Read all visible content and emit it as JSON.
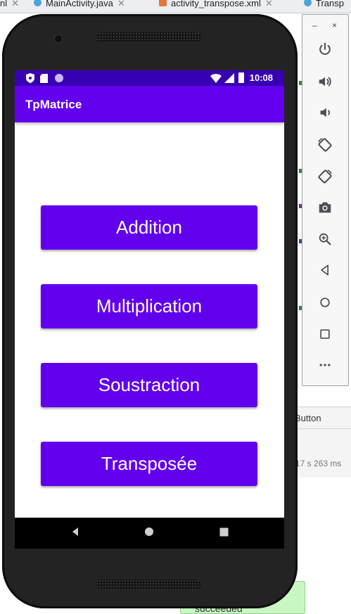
{
  "ide": {
    "tabs": [
      {
        "label": "nl"
      },
      {
        "label": "MainActivity.java"
      },
      {
        "label": "activity_transpose.xml"
      },
      {
        "label": "Transp"
      }
    ],
    "panel_label": "Button",
    "duration_text": "17 s 263 ms",
    "status_text": "succeeded"
  },
  "emulator": {
    "minimize": "–",
    "close": "×",
    "tools": [
      "power-icon",
      "volume-up-icon",
      "volume-down-icon",
      "rotate-left-icon",
      "rotate-right-icon",
      "camera-icon",
      "zoom-icon",
      "back-icon",
      "home-icon",
      "overview-icon",
      "more-icon"
    ]
  },
  "phone": {
    "status_bar": {
      "time": "10:08"
    },
    "app_bar": {
      "title": "TpMatrice"
    },
    "buttons": {
      "addition": "Addition",
      "multiplication": "Multiplication",
      "soustraction": "Soustraction",
      "transposee": "Transposée"
    }
  },
  "colors": {
    "primary": "#6200ee",
    "primary_dark": "#3700b3",
    "nav_bar": "#000000"
  }
}
